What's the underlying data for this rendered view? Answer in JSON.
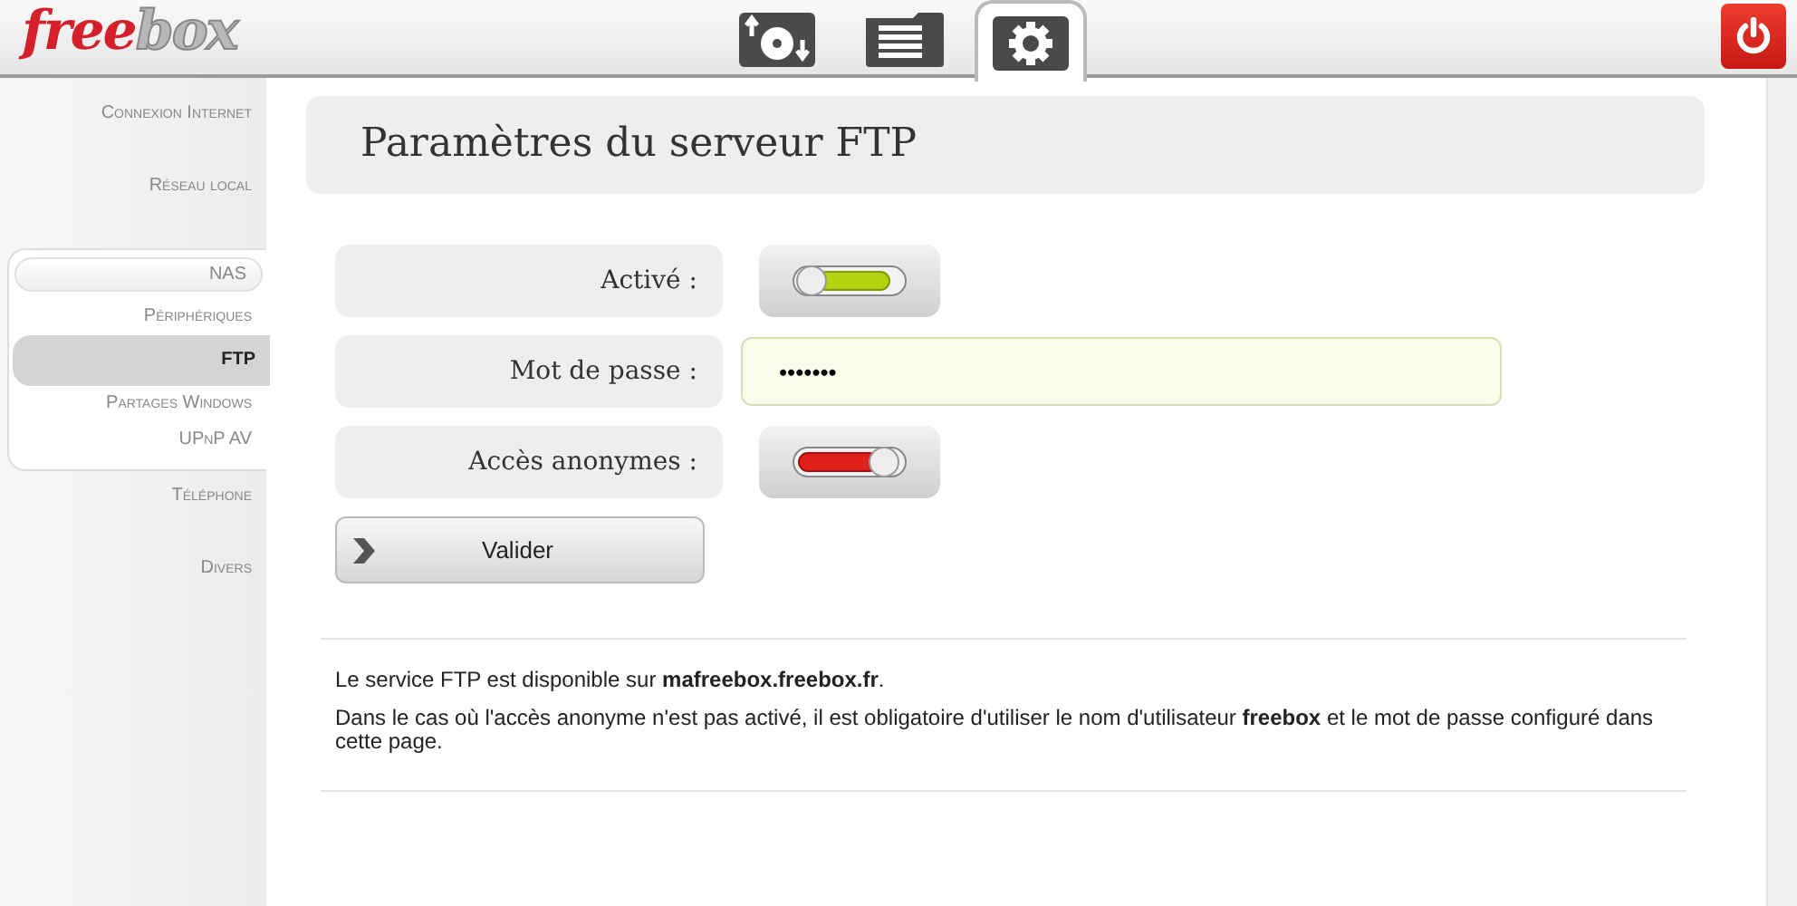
{
  "logo": [
    {
      "text": "free",
      "color": "#d4202a"
    },
    {
      "text": "box",
      "color": "#b8b8b8"
    }
  ],
  "top_tabs": [
    {
      "kind": "disk",
      "selected": false
    },
    {
      "kind": "list",
      "selected": false
    },
    {
      "kind": "settings",
      "selected": true
    }
  ],
  "sidebar": {
    "items": [
      {
        "label": "Connexion Internet",
        "selected": false
      },
      {
        "label": "Réseau local",
        "selected": false
      },
      {
        "label": "NAS",
        "selected": false,
        "children": [
          {
            "label": "Périphériques",
            "selected": false
          },
          {
            "label": "FTP",
            "selected": true
          },
          {
            "label": "Partages Windows",
            "selected": false
          },
          {
            "label": "UPnP AV",
            "selected": false
          }
        ]
      },
      {
        "label": "Téléphone",
        "selected": false
      },
      {
        "label": "Divers",
        "selected": false
      }
    ]
  },
  "page_title": "Paramètres du serveur FTP",
  "form": [
    {
      "kind": "toggle",
      "label": "Activé :",
      "on": true
    },
    {
      "kind": "password",
      "label": "Mot de passe :",
      "value": "•••••••"
    },
    {
      "kind": "toggle",
      "label": "Accès anonymes :",
      "on": false
    }
  ],
  "submit_button": "Valider",
  "info": [
    "Le service FTP est disponible sur **mafreebox.freebox.fr**.",
    "Dans le cas où l'accès anonyme n'est pas activé, il est obligatoire d'utiliser le nom d'utilisateur **freebox** et le mot de passe configuré dans cette page."
  ]
}
